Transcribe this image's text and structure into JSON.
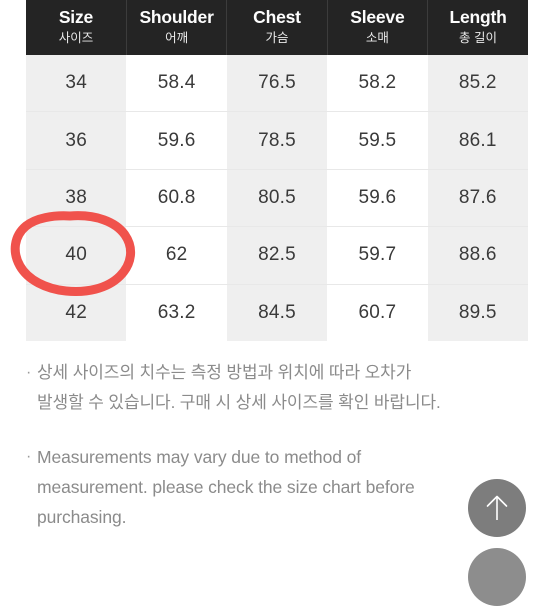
{
  "table": {
    "columns": [
      {
        "en": "Size",
        "ko": "사이즈",
        "key": "size"
      },
      {
        "en": "Shoulder",
        "ko": "어깨",
        "key": "shoulder"
      },
      {
        "en": "Chest",
        "ko": "가슴",
        "key": "chest"
      },
      {
        "en": "Sleeve",
        "ko": "소매",
        "key": "sleeve"
      },
      {
        "en": "Length",
        "ko": "총 길이",
        "key": "length"
      }
    ],
    "rows": [
      {
        "size": "34",
        "shoulder": "58.4",
        "chest": "76.5",
        "sleeve": "58.2",
        "length": "85.2"
      },
      {
        "size": "36",
        "shoulder": "59.6",
        "chest": "78.5",
        "sleeve": "59.5",
        "length": "86.1"
      },
      {
        "size": "38",
        "shoulder": "60.8",
        "chest": "80.5",
        "sleeve": "59.6",
        "length": "87.6"
      },
      {
        "size": "40",
        "shoulder": "62",
        "chest": "82.5",
        "sleeve": "59.7",
        "length": "88.6"
      },
      {
        "size": "42",
        "shoulder": "63.2",
        "chest": "84.5",
        "sleeve": "60.7",
        "length": "89.5"
      }
    ]
  },
  "annotation": {
    "type": "hand-drawn-circle",
    "highlights_value": "40",
    "color": "#f0524c"
  },
  "notes": [
    {
      "bullet": "·",
      "lines": [
        "상세 사이즈의 치수는 측정 방법과 위치에 따라 오차가",
        "발생할 수 있습니다. 구매 시 상세 사이즈를 확인 바랍니다."
      ]
    },
    {
      "bullet": "·",
      "lines": [
        "Measurements may vary due to method of",
        "measurement. please check the size chart before",
        "purchasing."
      ]
    }
  ],
  "floating": {
    "scroll_top_icon": "arrow-up-icon",
    "scroll_top_color": "#7d7d7d"
  },
  "colors": {
    "header_bg": "#242424",
    "shade_cell": "#efefef",
    "cell_text": "#3a3a3a",
    "note_text": "#8b8b8b",
    "annotation_red": "#f0524c"
  }
}
